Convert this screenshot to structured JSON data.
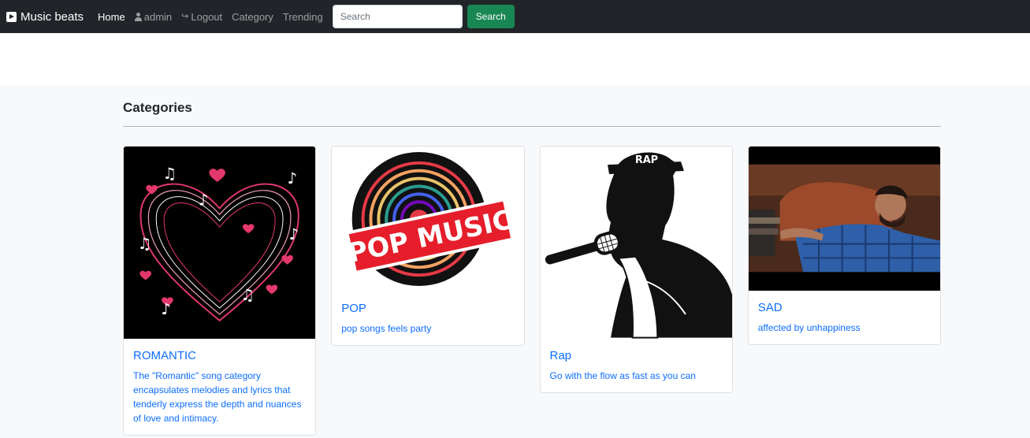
{
  "navbar": {
    "brand": "Music beats",
    "links": [
      {
        "label": "Home"
      },
      {
        "label": "admin"
      },
      {
        "label": "Logout"
      },
      {
        "label": "Category"
      },
      {
        "label": "Trending"
      }
    ],
    "search": {
      "placeholder": "Search",
      "value": ""
    },
    "search_button": "Search"
  },
  "page": {
    "heading": "Categories"
  },
  "categories": [
    {
      "title": "ROMANTIC",
      "description": "The \"Romantic\" song category encapsulates melodies and lyrics that tenderly express the depth and nuances of love and intimacy."
    },
    {
      "title": "POP",
      "description": "pop songs feels party",
      "image_text": "POP MUSIC"
    },
    {
      "title": "Rap",
      "description": "Go with the flow as fast as you can",
      "image_text": "RAP"
    },
    {
      "title": "SAD",
      "description": "affected by unhappiness"
    }
  ],
  "colors": {
    "navbar_bg": "#212529",
    "link_blue": "#0d6efd",
    "search_green": "#198754",
    "heart_pink": "#e3386b"
  }
}
